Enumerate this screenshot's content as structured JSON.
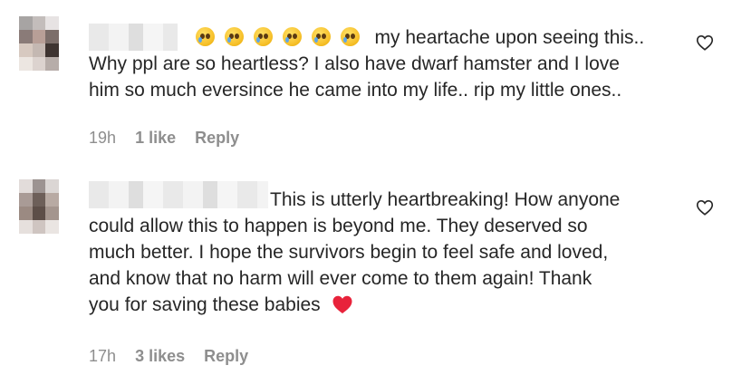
{
  "comments": [
    {
      "text_line1": "my heartache upon seeing this..",
      "text_rest": "Why ppl are so heartless? I also have dwarf hamster and I love him so much eversince he came into my life.. rip my little ones..",
      "line2": "Why ppl are so heartless? I also have dwarf hamster and I love",
      "line3": "him so much eversince he came into my life.. rip my little ones..",
      "emoji_count_desc": "pleading-face x6",
      "time": "19h",
      "likes": "1 like",
      "reply": "Reply"
    },
    {
      "line1": "This is utterly heartbreaking! How anyone",
      "line2": "could allow this to happen is beyond me. They deserved so",
      "line3": "much better. I hope the survivors begin to feel safe and loved,",
      "line4": "and know that no harm will ever come to them again! Thank",
      "line5": "you for saving these babies",
      "end_emoji": "red-heart",
      "time": "17h",
      "likes": "3 likes",
      "reply": "Reply"
    }
  ],
  "colors": {
    "text": "#262626",
    "meta": "#8e8e8e",
    "heart_emoji": "#e8233b"
  }
}
